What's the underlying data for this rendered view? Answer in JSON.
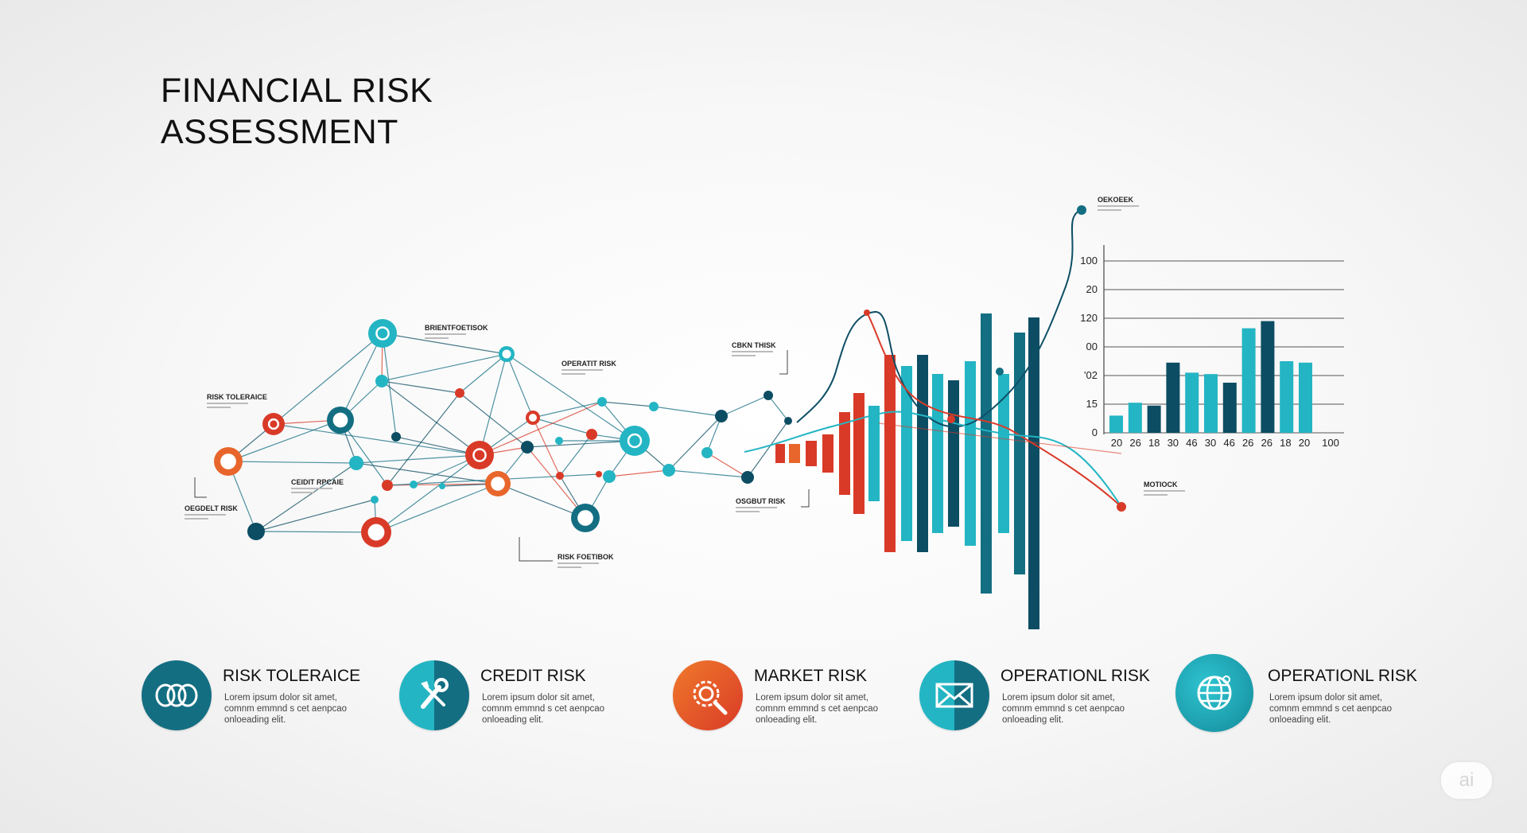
{
  "title": {
    "line1": "FINANCIAL RISK",
    "line2": "ASSESSMENT"
  },
  "colors": {
    "teal": "#23b5c3",
    "dark_teal": "#136e82",
    "navy": "#0c4d63",
    "red": "#d93a28",
    "orange": "#e8662c",
    "grid": "#555555"
  },
  "network_labels": [
    {
      "title": "RISK TOLERAICE"
    },
    {
      "title": "BRIENTFOETISOK"
    },
    {
      "title": "OPERATIT RISK"
    },
    {
      "title": "CEIDIT RPCAIE"
    },
    {
      "title": "OEGDELT RISK"
    },
    {
      "title": "RISK FOETIBOK"
    },
    {
      "title": "CBKN THISK"
    },
    {
      "title": "OSGBUT RISK"
    },
    {
      "title": "OEKOEEK"
    },
    {
      "title": "MOTIOCK"
    }
  ],
  "chart_data": [
    {
      "type": "bar",
      "title": "",
      "series": [
        {
          "values": [
            0.06,
            0.06,
            0.08,
            0.12,
            0.26,
            0.38,
            0.3,
            0.62,
            0.55,
            0.62,
            0.5,
            0.46,
            0.58,
            0.88,
            0.5,
            0.76,
            0.98
          ]
        }
      ]
    },
    {
      "type": "bar",
      "title": "",
      "y_ticks": [
        "100",
        "20",
        "120",
        "00",
        "'02",
        "15",
        "0"
      ],
      "x_ticks": [
        "20",
        "26",
        "18",
        "30",
        "46",
        "30",
        "46",
        "26",
        "26",
        "18",
        "20",
        "100"
      ],
      "values": [
        0.12,
        0.21,
        0.19,
        0.49,
        0.42,
        0.41,
        0.35,
        0.73,
        0.78,
        0.5,
        0.49
      ],
      "ylim": [
        0,
        1.2
      ],
      "grid": true
    }
  ],
  "categories": [
    {
      "title": "RISK TOLERAICE",
      "desc": "Lorem ipsum dolor sit amet, comnm emmnd s cet aenpcao onloeading elit.",
      "icon": "link-chain-icon"
    },
    {
      "title": "CREDIT RISK",
      "desc": "Lorem ipsum dolor sit amet, comnm emmnd s cet aenpcao onloeading elit.",
      "icon": "tools-icon"
    },
    {
      "title": "MARKET RISK",
      "desc": "Lorem ipsum dolor sit amet, comnm emmnd s cet aenpcao onloeading elit.",
      "icon": "gear-search-icon"
    },
    {
      "title": "OPERATIONL RISK",
      "desc": "Lorem ipsum dolor sit amet, comnm emmnd s cet aenpcao onloeading elit.",
      "icon": "envelope-icon"
    },
    {
      "title": "OPERATIONL RISK",
      "desc": "Lorem ipsum dolor sit amet, comnm emmnd s cet aenpcao onloeading elit.",
      "icon": "globe-icon"
    }
  ],
  "badge": {
    "label": "ai"
  }
}
